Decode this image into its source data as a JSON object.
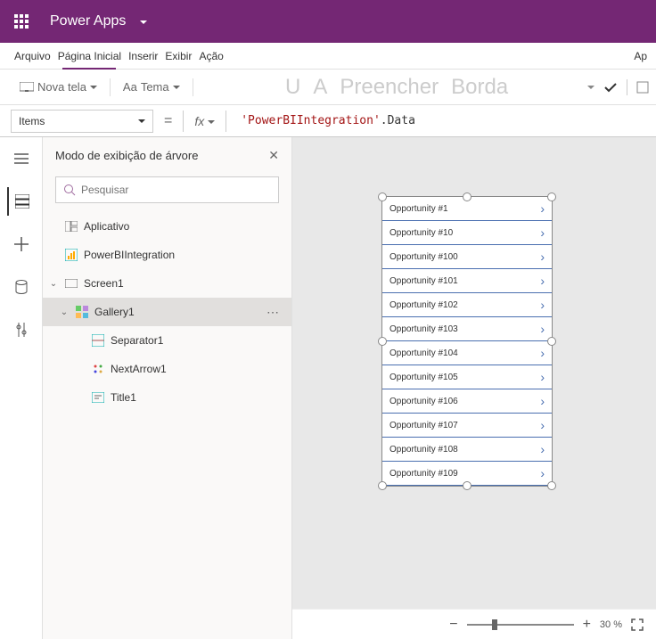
{
  "header": {
    "title": "Power Apps"
  },
  "menu": {
    "arquivo": "Arquivo",
    "pagina": "Página Inicial",
    "inserir": "Inserir",
    "exibir": "Exibir",
    "acao": "Ação",
    "right": "Ap"
  },
  "toolbar": {
    "novatela": "Nova tela",
    "tema": "Tema",
    "wm1": "U",
    "wm2": "A",
    "wm3": "Preencher",
    "wm4": "Borda"
  },
  "formula": {
    "property": "Items",
    "value_str": "'PowerBIIntegration'",
    "value_suffix": ".Data"
  },
  "treeview": {
    "title": "Modo de exibição de árvore",
    "search_placeholder": "Pesquisar",
    "aplicativo": "Aplicativo",
    "pbi": "PowerBIIntegration",
    "screen1": "Screen1",
    "gallery1": "Gallery1",
    "separator1": "Separator1",
    "nextarrow1": "NextArrow1",
    "title1": "Title1"
  },
  "gallery": {
    "items": [
      "Opportunity #1",
      "Opportunity #10",
      "Opportunity #100",
      "Opportunity #101",
      "Opportunity #102",
      "Opportunity #103",
      "Opportunity #104",
      "Opportunity #105",
      "Opportunity #106",
      "Opportunity #107",
      "Opportunity #108",
      "Opportunity #109"
    ]
  },
  "status": {
    "zoom": "30",
    "unit": "%"
  }
}
